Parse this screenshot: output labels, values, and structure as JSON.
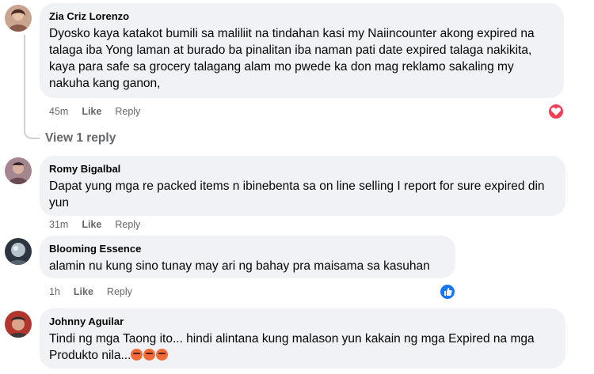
{
  "comments": [
    {
      "author": "Zia Criz Lorenzo",
      "text": "Dyosko kaya katakot bumili sa maliliit na tindahan kasi my Naiincounter akong expired na talaga iba Yong laman at burado ba pinalitan iba naman pati date expired talaga nakikita, kaya para safe sa grocery talagang alam mo pwede ka don mag reklamo sakaling my nakuha kang ganon,",
      "time": "45m",
      "like": "Like",
      "reply": "Reply",
      "reaction": "heart-reaction-icon",
      "view_replies": "View 1 reply"
    },
    {
      "author": "Romy Bigalbal",
      "text": "Dapat yung mga re packed items n ibinebenta sa on line selling I report for sure expired din yun",
      "time": "31m",
      "like": "Like",
      "reply": "Reply"
    },
    {
      "author": "Blooming Essence",
      "text": "alamin nu kung sino tunay may ari ng bahay pra maisama sa kasuhan",
      "time": "1h",
      "like": "Like",
      "reply": "Reply",
      "reaction": "thumbs-up-reaction-icon"
    },
    {
      "author": "Johnny Aguilar",
      "text": "Tindi ng mga Taong ito... hindi alintana kung malason yun kakain ng mga Expired na mga Produkto nila...",
      "emojis": "angry-face-icon x3"
    }
  ],
  "colors": {
    "bubble_bg": "#f0f2f5",
    "meta_text": "#65676b",
    "heart_reaction": "#f33e58",
    "like_reaction": "#1877f2"
  }
}
